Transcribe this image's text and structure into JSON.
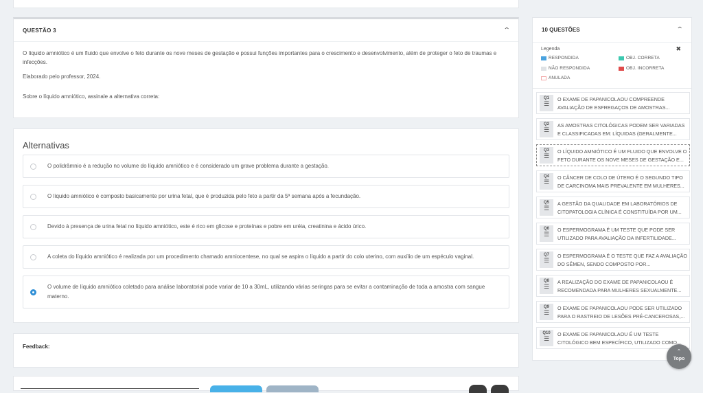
{
  "question": {
    "title": "QUESTÃO 3",
    "paragraph1": "O líquido amniótico é um fluido que envolve o feto durante os nove meses de gestação e possui funções importantes para o crescimento e desenvolvimento, além de proteger o feto de traumas e infecções.",
    "paragraph2": "Elaborado pelo professor, 2024.",
    "prompt": "Sobre o líquido amniótico, assinale a alternativa correta:"
  },
  "alternatives": {
    "title": "Alternativas",
    "items": [
      {
        "text": "O polidrâmnio é a redução no volume do líquido amniótico e é considerado um grave problema durante a gestação.",
        "selected": false
      },
      {
        "text": "O líquido amniótico é composto basicamente por urina fetal, que é produzida pelo feto a partir da 5ª semana após a fecundação.",
        "selected": false
      },
      {
        "text": "Devido à presença de urina fetal no líquido amniótico, este é rico em glicose e proteínas e pobre em uréia, creatinina e ácido úrico.",
        "selected": false
      },
      {
        "text": "A coleta do líquido amniótico é realizada por um procedimento chamado amniocentese, no qual se aspira o líquido a partir do colo uterino, com auxílio de um espéculo vaginal.",
        "selected": false
      },
      {
        "text": "O volume de líquido amniótico coletado para análise laboratorial pode variar de 10 a 30mL, utilizando várias seringas para se evitar a contaminação de toda a amostra com sangue materno.",
        "selected": true
      }
    ]
  },
  "feedback": {
    "label": "Feedback:"
  },
  "sidebar": {
    "title": "10 QUESTÕES",
    "legend": {
      "title": "Legenda",
      "items": [
        {
          "label": "RESPONDIDA",
          "color": "#4aa3df"
        },
        {
          "label": "OBJ. CORRETA",
          "color": "#3cc9b0"
        },
        {
          "label": "NÃO RESPONDIDA",
          "color": "#dfe2e5"
        },
        {
          "label": "OBJ. INCORRETA",
          "color": "#e04b4b"
        },
        {
          "label": "ANULADA",
          "color": "#f2a9a9"
        }
      ]
    },
    "questions": [
      {
        "num": "Q1",
        "text": "O EXAME DE PAPANICOLAOU COMPREENDE AVALIAÇÃO DE ESFREGAÇOS DE AMOSTRAS..."
      },
      {
        "num": "Q2",
        "text": "AS AMOSTRAS CITOLÓGICAS PODEM SER VARIADAS E CLASSIFICADAS EM: LÍQUIDAS (GERALMENTE..."
      },
      {
        "num": "Q3",
        "text": "O LÍQUIDO AMNIÓTICO É UM FLUIDO QUE ENVOLVE O FETO DURANTE OS NOVE MESES DE GESTAÇÃO E..."
      },
      {
        "num": "Q4",
        "text": "O CÂNCER DE COLO DE ÚTERO É O SEGUNDO TIPO DE CARCINOMA MAIS PREVALENTE EM MULHERES..."
      },
      {
        "num": "Q5",
        "text": "A GESTÃO DA QUALIDADE EM LABORATÓRIOS DE CITOPATOLOGIA CLÍNICA É CONSTITUÍDA POR UM..."
      },
      {
        "num": "Q6",
        "text": "O ESPERMOGRAMA É UM TESTE QUE PODE SER UTILIZADO PARA AVALIAÇÃO DA INFERTILIDADE..."
      },
      {
        "num": "Q7",
        "text": "O ESPERMOGRAMA É O TESTE QUE FAZ A AVALIAÇÃO DO SÊMEN, SENDO COMPOSTO POR..."
      },
      {
        "num": "Q8",
        "text": "A REALIZAÇÃO DO EXAME DE PAPANICOLAOU É RECOMENDADA PARA MULHERES SEXUALMENTE..."
      },
      {
        "num": "Q9",
        "text": "O EXAME DE PAPANICOLAOU PODE SER UTILIZADO PARA O RASTREIO DE LESÕES PRÉ-CANCEROSAS,..."
      },
      {
        "num": "Q10",
        "text": "O EXAME DE PAPANICOLAOU É UM TESTE CITOLÓGICO BEM ESPECÍFICO, UTILIZADO COMO..."
      }
    ]
  },
  "topo": {
    "label": "Topo"
  }
}
